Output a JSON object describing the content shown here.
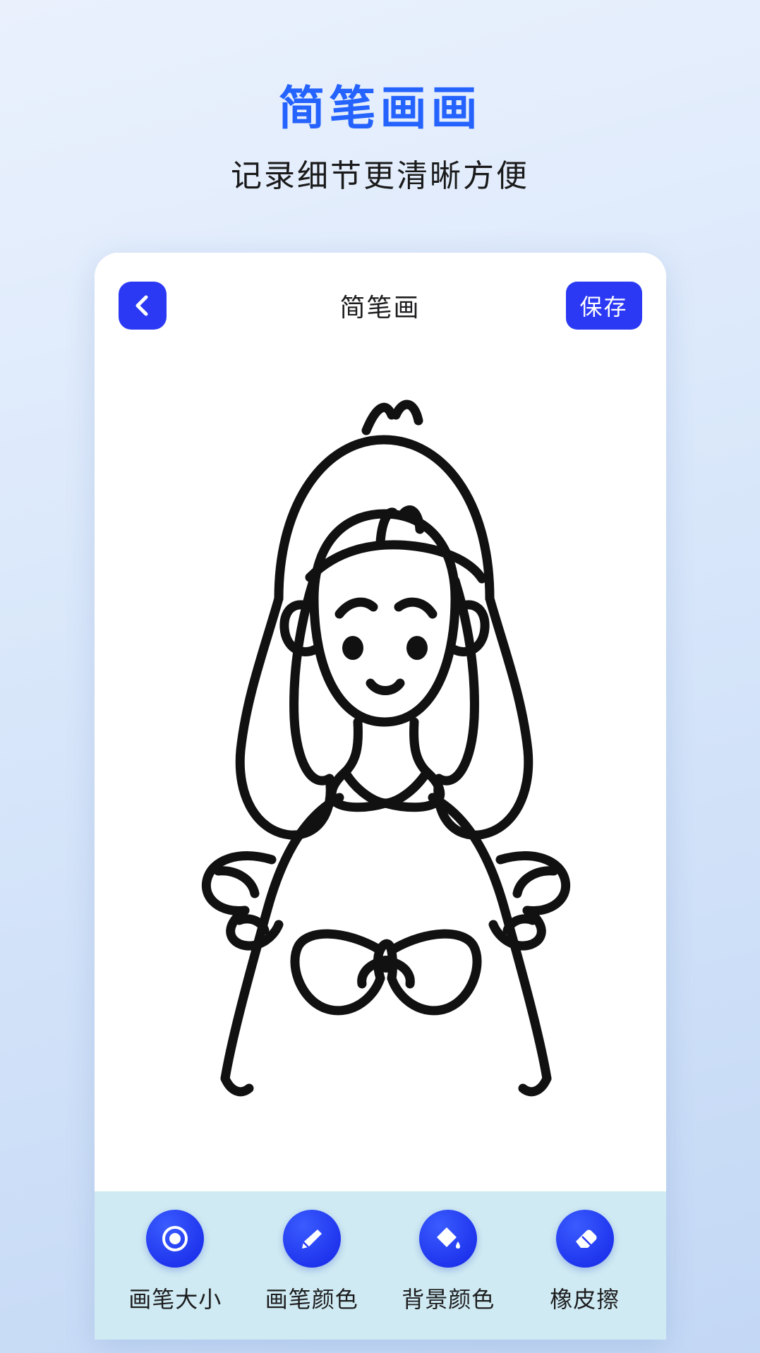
{
  "promo": {
    "headline": "简笔画画",
    "subhead": "记录细节更清晰方便"
  },
  "app": {
    "topbar": {
      "back_icon": "chevron-left-icon",
      "title": "简笔画",
      "save_label": "保存"
    },
    "canvas": {
      "description": "黑色线条简笔画：扎双马尾的女孩，穿着带蝴蝶结的连衣裙",
      "stroke_color": "#111111",
      "background_color": "#ffffff"
    },
    "toolbar": {
      "background_color": "#cfeaf2",
      "accent_color": "#2b39f5",
      "items": [
        {
          "icon": "brush-size-icon",
          "label": "画笔大小"
        },
        {
          "icon": "pen-color-icon",
          "label": "画笔颜色"
        },
        {
          "icon": "fill-bucket-icon",
          "label": "背景颜色"
        },
        {
          "icon": "eraser-icon",
          "label": "橡皮擦"
        }
      ]
    }
  },
  "theme": {
    "headline_color": "#2563ff",
    "text_color": "#1a1a1a",
    "page_background": "#dce9fb"
  }
}
